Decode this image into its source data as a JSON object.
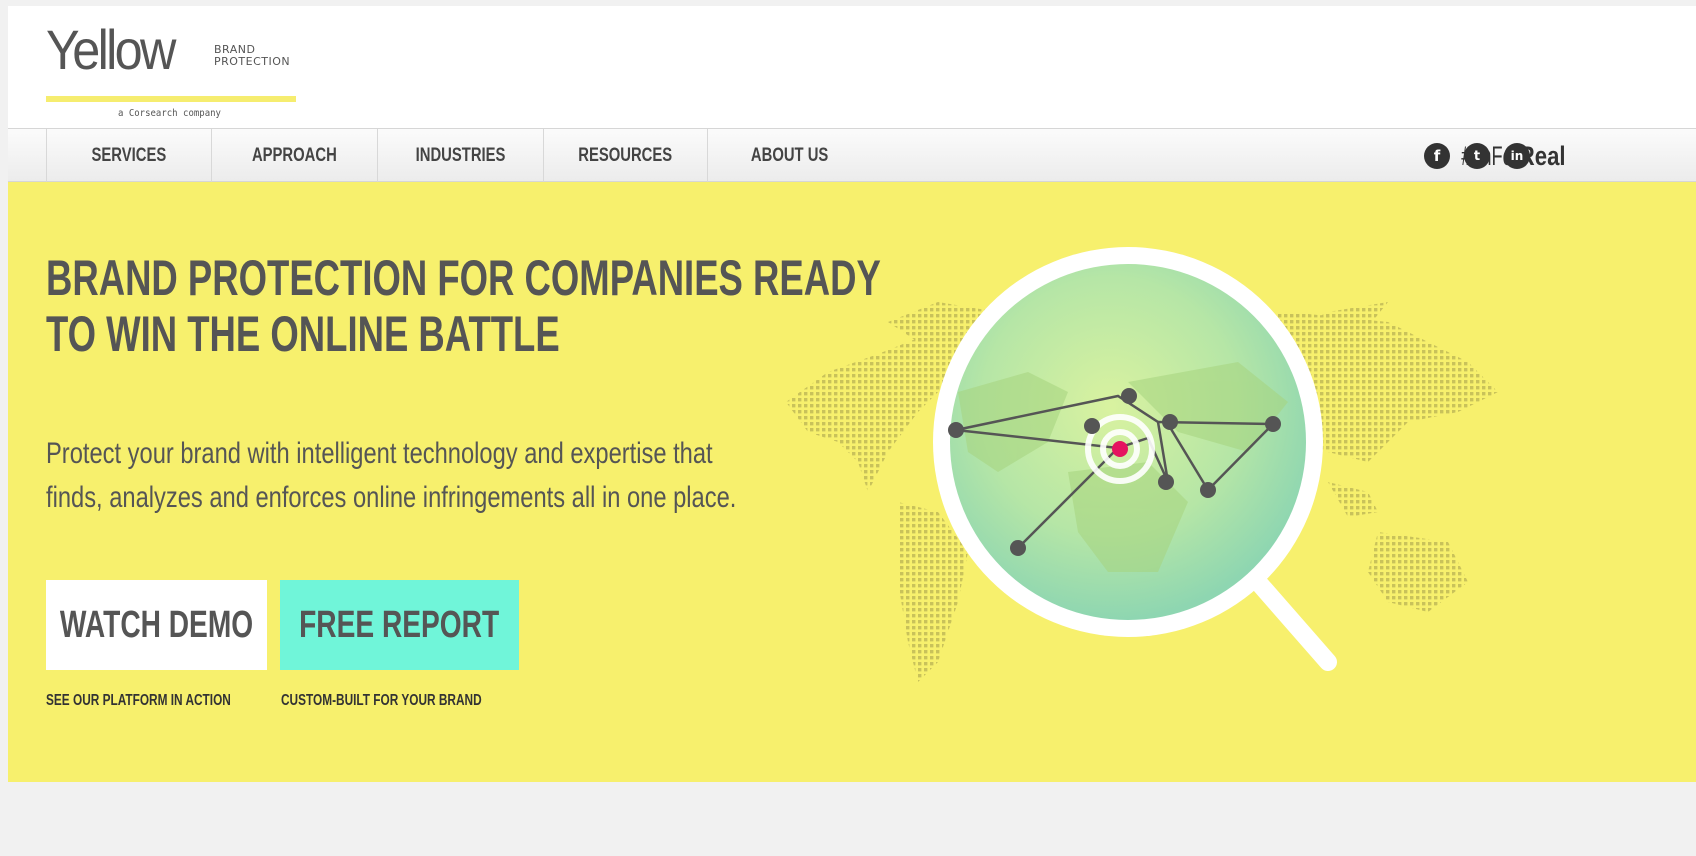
{
  "logo": {
    "main": "Yellow",
    "sub_line1": "BRAND",
    "sub_line2": "PROTECTION",
    "tagline": "a Corsearch company"
  },
  "nav": {
    "items": [
      "SERVICES",
      "APPROACH",
      "INDUSTRIES",
      "RESOURCES",
      "ABOUT US"
    ],
    "hashtag_prefix": "#ImFor",
    "hashtag_bold": "Real",
    "social": [
      {
        "name": "facebook-icon",
        "glyph": "f"
      },
      {
        "name": "twitter-icon",
        "glyph": "t"
      },
      {
        "name": "linkedin-icon",
        "glyph": "in"
      }
    ]
  },
  "hero": {
    "headline_line1": "BRAND PROTECTION FOR COMPANIES READY",
    "headline_line2": "TO WIN THE ONLINE BATTLE",
    "subcopy_line1": "Protect your brand with intelligent technology and expertise that",
    "subcopy_line2": "finds, analyzes and enforces online infringements all in one place.",
    "watch_demo_label": "WATCH DEMO",
    "free_report_label": "FREE REPORT",
    "watch_demo_caption": "SEE OUR PLATFORM IN ACTION",
    "free_report_caption": "CUSTOM-BUILT FOR YOUR BRAND"
  },
  "colors": {
    "hero_bg": "#f7f06d",
    "accent_teal": "#70f5d9",
    "target_pink": "#e5145f",
    "text_gray": "#555555"
  }
}
